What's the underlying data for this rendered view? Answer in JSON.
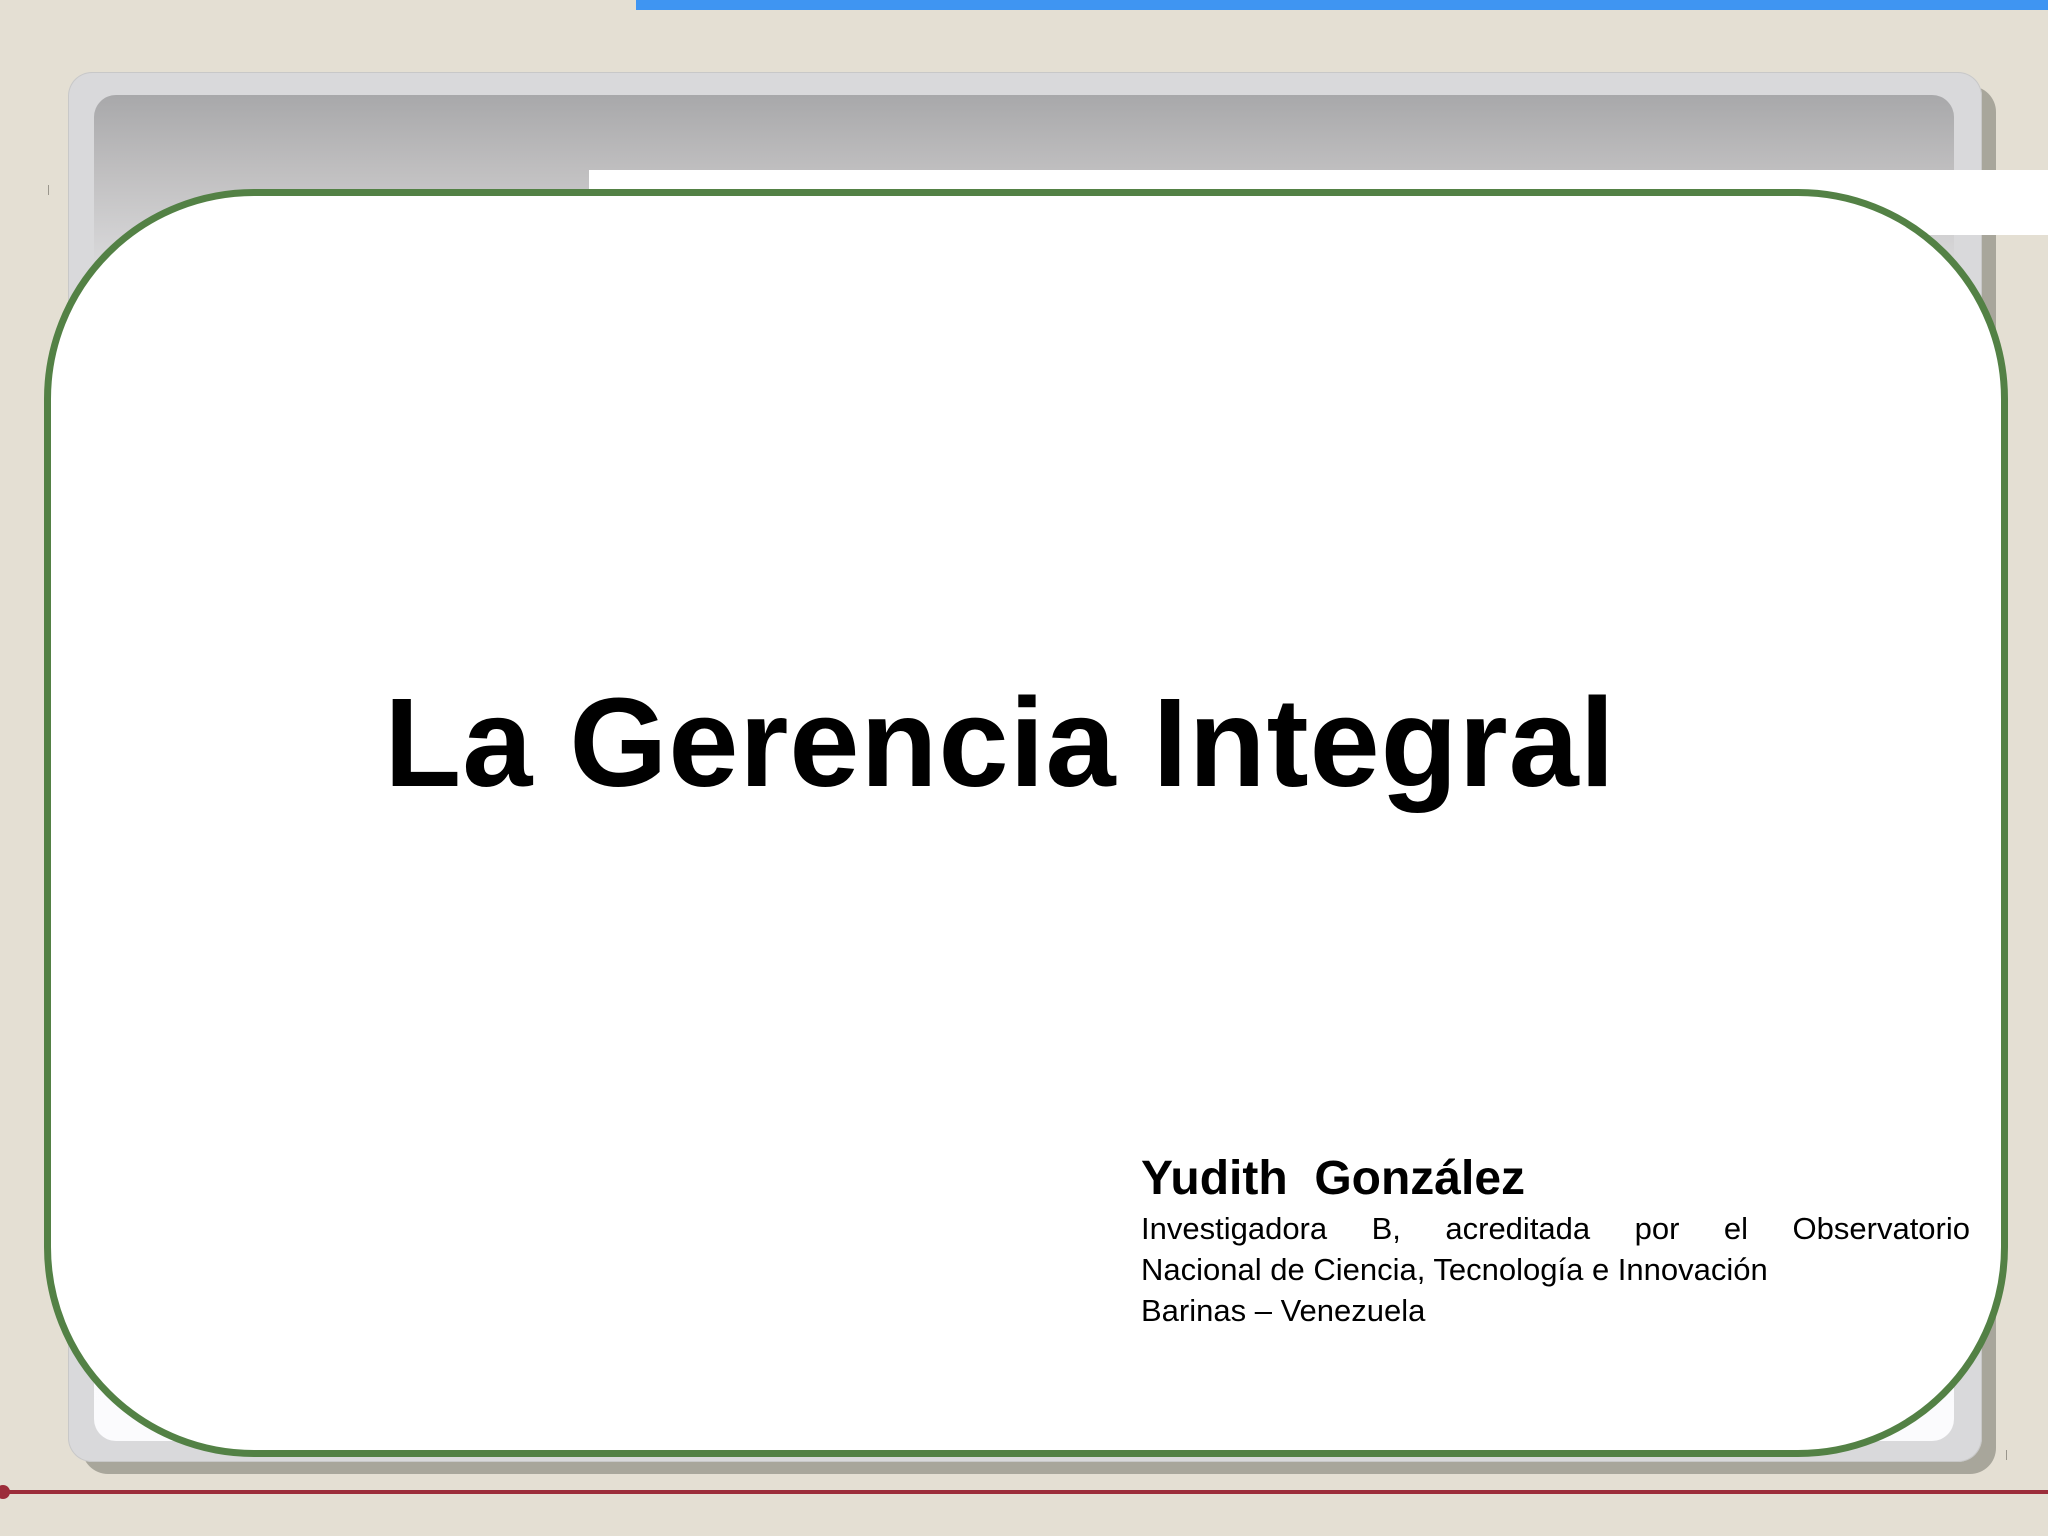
{
  "slide": {
    "title": "La Gerencia Integral",
    "author": {
      "name": "Yudith  González",
      "affiliation_line_1": "Investigadora B, acreditada por el Observatorio",
      "affiliation_line_2": "Nacional de Ciencia, Tecnología e Innovación",
      "location": "Barinas – Venezuela"
    }
  },
  "colors": {
    "background": "#e4dfd3",
    "top_accent": "#3f95f2",
    "card_border": "#538145",
    "bottom_rule": "#9c2d3a",
    "text": "#000000"
  }
}
